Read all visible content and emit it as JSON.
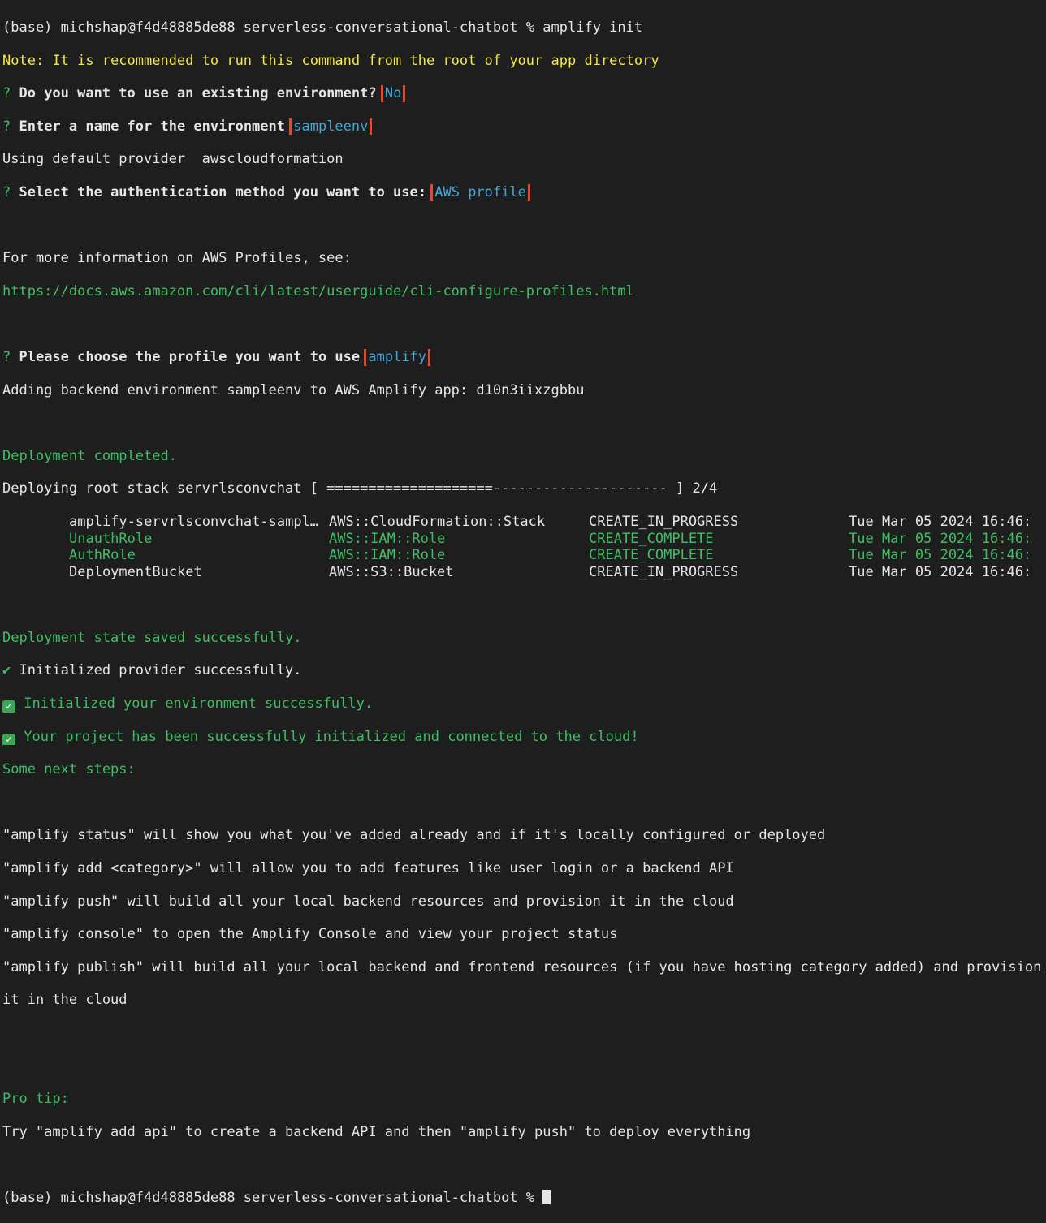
{
  "prompt": {
    "start": "(base) michshap@f4d48885de88 serverless-conversational-chatbot % ",
    "command": "amplify init",
    "end": "(base) michshap@f4d48885de88 serverless-conversational-chatbot % "
  },
  "note": "Note: It is recommended to run this command from the root of your app directory",
  "questions": {
    "existing_env": {
      "mark": "? ",
      "label": "Do you want to use an existing environment?",
      "answer": "No"
    },
    "env_name": {
      "mark": "? ",
      "label": "Enter a name for the environment",
      "answer": "sampleenv"
    },
    "auth_method": {
      "mark": "? ",
      "label": "Select the authentication method you want to use:",
      "answer": "AWS profile"
    },
    "profile": {
      "mark": "? ",
      "label": "Please choose the profile you want to use",
      "answer": "amplify"
    }
  },
  "provider_line": "Using default provider  awscloudformation",
  "profiles_info": "For more information on AWS Profiles, see:",
  "profiles_url": "https://docs.aws.amazon.com/cli/latest/userguide/cli-configure-profiles.html",
  "adding_backend": "Adding backend environment sampleenv to AWS Amplify app: d10n3iixzgbbu",
  "deployment_completed": "Deployment completed.",
  "deploying_line": "Deploying root stack servrlsconvchat [ ====================--------------------- ] 2/4",
  "resources": [
    {
      "name": "amplify-servrlsconvchat-sampl…",
      "type": "AWS::CloudFormation::Stack",
      "status": "CREATE_IN_PROGRESS",
      "time": "Tue Mar 05 2024 16:46:",
      "done": false
    },
    {
      "name": "UnauthRole",
      "type": "AWS::IAM::Role",
      "status": "CREATE_COMPLETE",
      "time": "Tue Mar 05 2024 16:46:",
      "done": true
    },
    {
      "name": "AuthRole",
      "type": "AWS::IAM::Role",
      "status": "CREATE_COMPLETE",
      "time": "Tue Mar 05 2024 16:46:",
      "done": true
    },
    {
      "name": "DeploymentBucket",
      "type": "AWS::S3::Bucket",
      "status": "CREATE_IN_PROGRESS",
      "time": "Tue Mar 05 2024 16:46:",
      "done": false
    }
  ],
  "state_saved": "Deployment state saved successfully.",
  "init_provider": {
    "mark": "✔",
    "text": " Initialized provider successfully."
  },
  "init_env": {
    "mark": "✓",
    "text": " Initialized your environment successfully."
  },
  "project_init": {
    "mark": "✓",
    "text": " Your project has been successfully initialized and connected to the cloud!"
  },
  "next_steps_title": "Some next steps:",
  "next_steps": [
    "\"amplify status\" will show you what you've added already and if it's locally configured or deployed",
    "\"amplify add <category>\" will allow you to add features like user login or a backend API",
    "\"amplify push\" will build all your local backend resources and provision it in the cloud",
    "\"amplify console\" to open the Amplify Console and view your project status",
    "\"amplify publish\" will build all your local backend and frontend resources (if you have hosting category added) and provision",
    "it in the cloud"
  ],
  "pro_tip_title": "Pro tip:",
  "pro_tip": "Try \"amplify add api\" to create a backend API and then \"amplify push\" to deploy everything",
  "colors": {
    "background": "#1e1e1e",
    "highlight_box": "#e8492d",
    "green": "#3fbf63",
    "yellow": "#f2e64b",
    "cyan": "#3fa8d8"
  }
}
